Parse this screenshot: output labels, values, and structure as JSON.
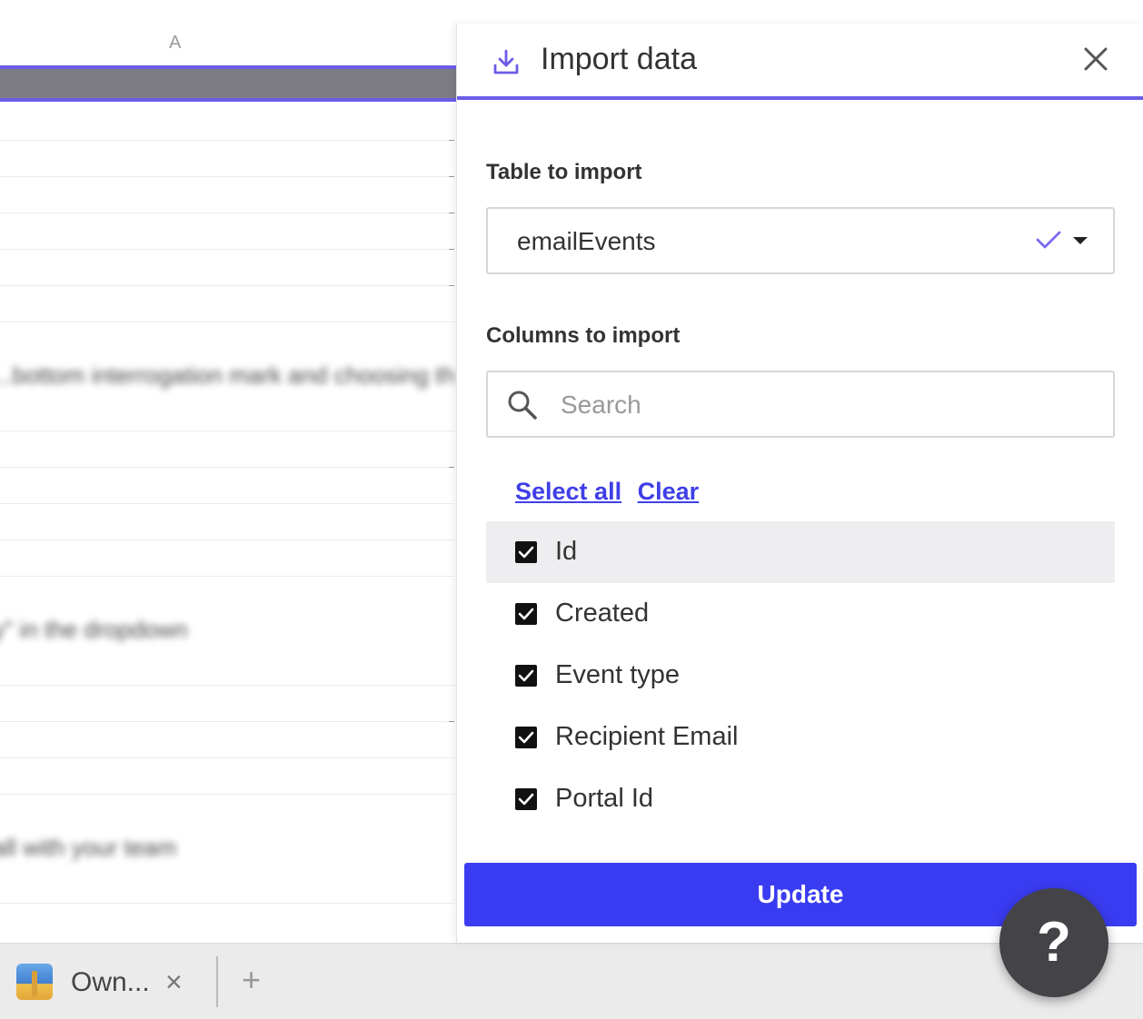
{
  "sheet": {
    "column_letter": "A",
    "blurred_rows": [
      "...bottom interrogation mark and choosing the g",
      "y\" in the dropdown",
      "all with your team"
    ]
  },
  "panel": {
    "title": "Import data",
    "icon": "download-icon",
    "close_icon": "close-icon",
    "table_section": {
      "label": "Table to import",
      "selected": "emailEvents",
      "check_icon": "check-icon",
      "caret_icon": "caret-down-icon"
    },
    "columns_section": {
      "label": "Columns to import",
      "search_placeholder": "Search",
      "select_all": "Select all",
      "clear": "Clear",
      "columns": [
        {
          "name": "Id",
          "checked": true
        },
        {
          "name": "Created",
          "checked": true
        },
        {
          "name": "Event type",
          "checked": true
        },
        {
          "name": "Recipient Email",
          "checked": true
        },
        {
          "name": "Portal Id",
          "checked": true
        }
      ]
    },
    "update_label": "Update"
  },
  "tabbar": {
    "tab_label": "Own...",
    "close_glyph": "×",
    "add_glyph": "+"
  },
  "help": {
    "label": "?"
  },
  "colors": {
    "accent": "#6c5ce7",
    "button": "#3a3cf2",
    "link": "#3f3fe8"
  }
}
